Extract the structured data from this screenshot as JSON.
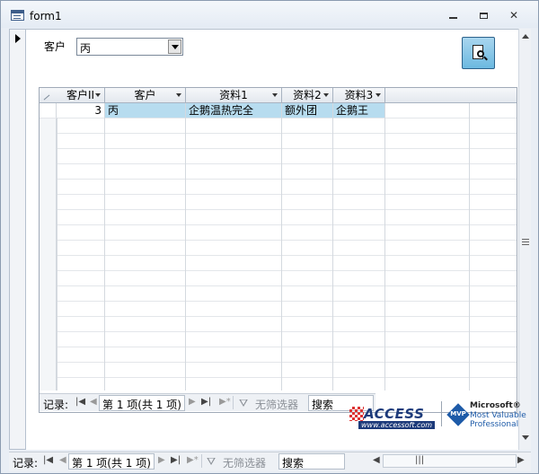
{
  "window": {
    "title": "form1",
    "minimize_label": "▁",
    "maximize_label": "□",
    "close_label": "✕"
  },
  "filter": {
    "label": "客户",
    "value": "丙"
  },
  "subform": {
    "columns": [
      "客户II",
      "客户",
      "资料1",
      "资料2",
      "资料3"
    ],
    "rows": [
      [
        "3",
        "丙",
        "企鹅温热完全",
        "额外团",
        "企鹅王"
      ]
    ],
    "nav": {
      "record_label": "记录:",
      "position": "第 1 项(共 1 项)",
      "filter_text": "无筛选器",
      "search": "搜索"
    }
  },
  "main_nav": {
    "record_label": "记录:",
    "position": "第 1 项(共 1 项)",
    "filter_text": "无筛选器",
    "search": "搜索"
  },
  "logos": {
    "access_text": "ACCESS",
    "access_url": "www.accessoft.com",
    "mvp_badge": "MVP",
    "mvp_line1": "Microsoft®",
    "mvp_line2": "Most Valuable",
    "mvp_line3": "Professional"
  },
  "colors": {
    "selected_row": "#b7dcef",
    "preview_button": "#6cb9e0"
  },
  "icons": {
    "preview": "print-preview-icon",
    "form": "form-icon"
  }
}
